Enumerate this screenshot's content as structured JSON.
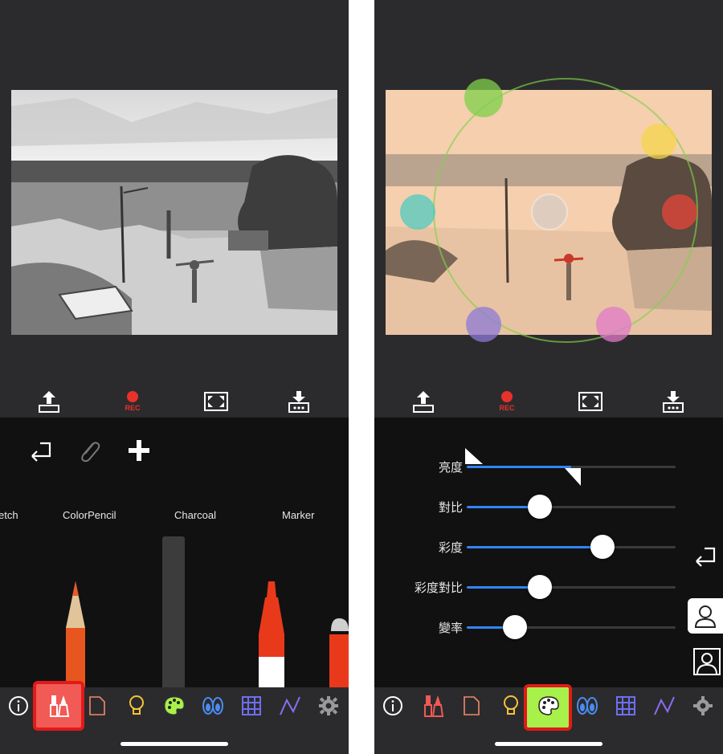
{
  "left_screen": {
    "toolbar": {
      "share_icon": "share-icon",
      "rec_label": "REC",
      "fullscreen_icon": "fullscreen-icon",
      "download_icon": "download-icon"
    },
    "panel": {
      "undo_icon": "undo-icon",
      "attach_icon": "paperclip-icon",
      "add_icon": "plus-icon"
    },
    "brushes": [
      {
        "label": "etch"
      },
      {
        "label": "ColorPencil"
      },
      {
        "label": "Charcoal"
      },
      {
        "label": "Marker"
      }
    ]
  },
  "right_screen": {
    "toolbar": {
      "share_icon": "share-icon",
      "rec_label": "REC",
      "fullscreen_icon": "fullscreen-icon",
      "download_icon": "download-icon"
    },
    "sliders": [
      {
        "label": "亮度",
        "value": 0.5,
        "style": "triangle"
      },
      {
        "label": "對比",
        "value": 0.35
      },
      {
        "label": "彩度",
        "value": 0.65
      },
      {
        "label": "彩度對比",
        "value": 0.35
      },
      {
        "label": "變率",
        "value": 0.23
      }
    ],
    "color_wheel_colors": [
      "#7fd14a",
      "#f5d64a",
      "#e8463a",
      "#e07ac8",
      "#8d7ad8",
      "#4fc9c0"
    ]
  },
  "bottom_bar": {
    "items": [
      "info-icon",
      "brush-icon",
      "paper-icon",
      "lightbulb-icon",
      "palette-icon",
      "eyes-icon",
      "grid-icon",
      "curve-icon",
      "gear-icon"
    ]
  },
  "colors": {
    "selected_left_bg": "#f25a55",
    "selected_right_bg": "#a8f04a",
    "selected_border": "#e11a1a",
    "rec_red": "#e8312a",
    "slider_blue": "#2f86f4"
  }
}
